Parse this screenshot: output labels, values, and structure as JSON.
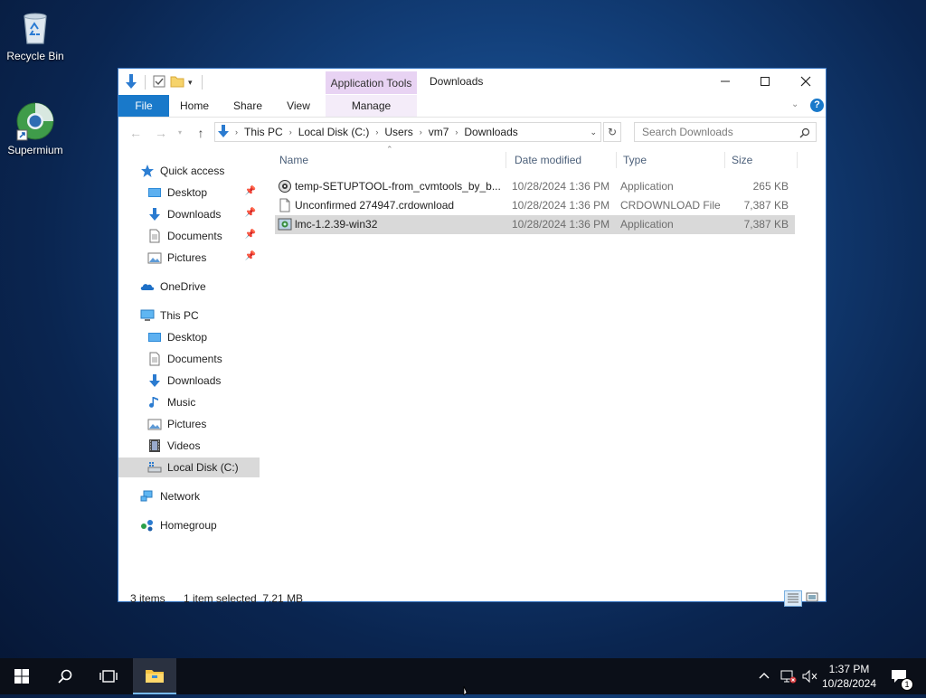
{
  "desktop": {
    "icons": [
      {
        "label": "Recycle Bin",
        "icon": "recycle-bin-icon"
      },
      {
        "label": "Supermium",
        "icon": "supermium-browser-icon"
      }
    ]
  },
  "window": {
    "title": "Downloads",
    "context_tab": "Application Tools",
    "ribbon_tabs": [
      "File",
      "Home",
      "Share",
      "View",
      "Manage"
    ],
    "address": {
      "crumbs": [
        "This PC",
        "Local Disk (C:)",
        "Users",
        "vm7",
        "Downloads"
      ]
    },
    "search": {
      "placeholder": "Search Downloads"
    },
    "nav": {
      "quick_access": "Quick access",
      "quick_items": [
        "Desktop",
        "Downloads",
        "Documents",
        "Pictures"
      ],
      "onedrive": "OneDrive",
      "this_pc": "This PC",
      "pc_items": [
        "Desktop",
        "Documents",
        "Downloads",
        "Music",
        "Pictures",
        "Videos",
        "Local Disk (C:)"
      ],
      "network": "Network",
      "homegroup": "Homegroup"
    },
    "columns": [
      "Name",
      "Date modified",
      "Type",
      "Size"
    ],
    "files": [
      {
        "name": "temp-SETUPTOOL-from_cvmtools_by_b...",
        "date": "10/28/2024 1:36 PM",
        "type": "Application",
        "size": "265 KB",
        "selected": false
      },
      {
        "name": "Unconfirmed 274947.crdownload",
        "date": "10/28/2024 1:36 PM",
        "type": "CRDOWNLOAD File",
        "size": "7,387 KB",
        "selected": false
      },
      {
        "name": "lmc-1.2.39-win32",
        "date": "10/28/2024 1:36 PM",
        "type": "Application",
        "size": "7,387 KB",
        "selected": true
      }
    ],
    "status": {
      "items": "3 items",
      "selection": "1 item selected  7.21 MB"
    }
  },
  "taskbar": {
    "time": "1:37 PM",
    "date": "10/28/2024",
    "notification_count": "1"
  },
  "colors": {
    "accent": "#1979ca",
    "context_tab": "#e8d3f3",
    "selection": "#d9d9d9"
  }
}
